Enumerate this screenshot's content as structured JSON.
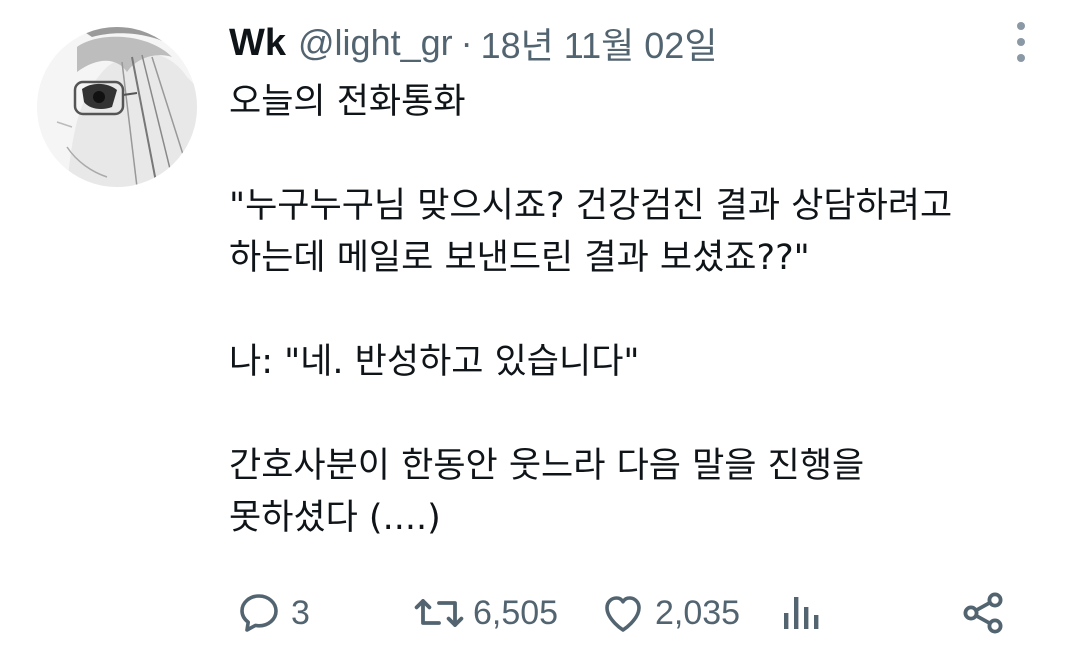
{
  "tweet": {
    "author_name": "Wk",
    "handle": "@light_gr",
    "separator": "·",
    "date": "18년 11월 02일",
    "lines": [
      "오늘의 전화통화",
      "",
      "\"누구누구님 맞으시죠? 건강검진 결과 상담하려고",
      "하는데 메일로 보낸드린 결과 보셨죠??\"",
      "",
      "나: \"네. 반성하고 있습니다\"",
      "",
      "간호사분이 한동안 웃느라 다음 말을 진행을",
      "못하셨다 (....)"
    ]
  },
  "actions": {
    "reply_count": "3",
    "retweet_count": "6,505",
    "like_count": "2,035"
  },
  "icons": {
    "more": "more-vertical-icon",
    "reply": "reply-icon",
    "retweet": "retweet-icon",
    "like": "heart-icon",
    "views": "views-icon",
    "share": "share-icon"
  },
  "colors": {
    "text_primary": "#0f1419",
    "text_secondary": "#536471",
    "background": "#ffffff"
  }
}
